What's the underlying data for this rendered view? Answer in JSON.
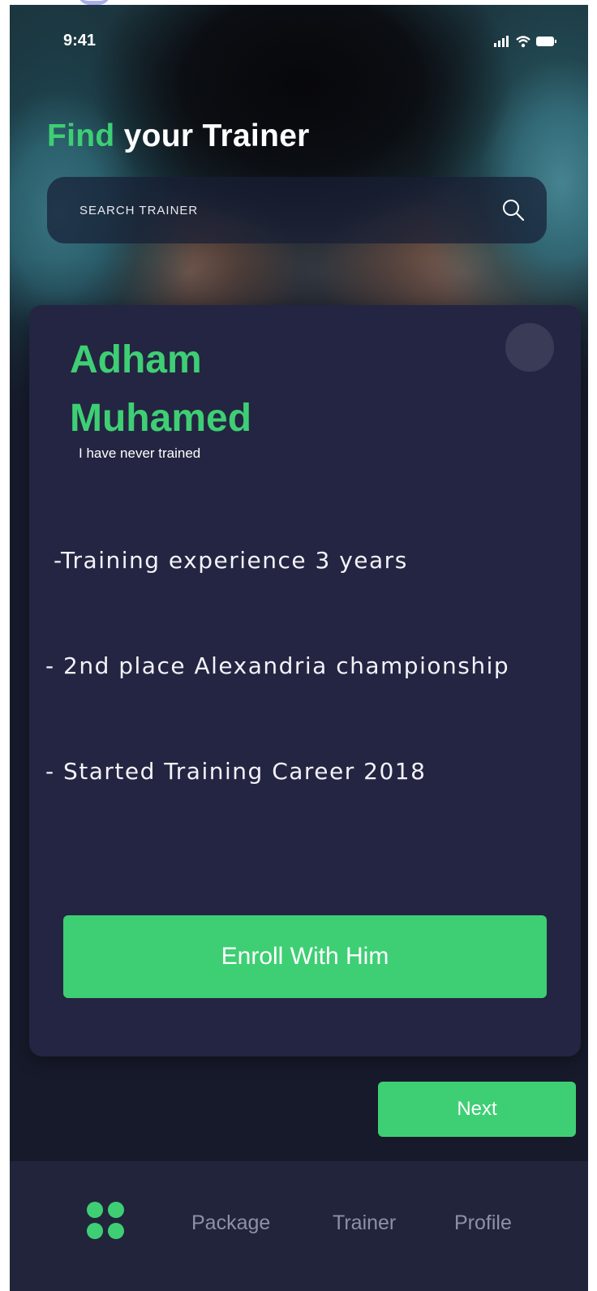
{
  "status_bar": {
    "time": "9:41",
    "icons": [
      "signal-icon",
      "wifi-icon",
      "battery-icon"
    ]
  },
  "header": {
    "title_accent": "Find",
    "title_rest": " your Trainer"
  },
  "search": {
    "placeholder": "SEARCH TRAINER",
    "icon": "search-icon"
  },
  "trainer_card": {
    "name_first": "Adham",
    "name_last": "Muhamed",
    "tagline": "I have never trained",
    "details": [
      "-Training experience 3 years",
      "- 2nd place Alexandria championship",
      "- Started Training Career 2018"
    ],
    "enroll_label": "Enroll With Him"
  },
  "next_label": "Next",
  "bottom_nav": {
    "items": [
      {
        "icon": "grid-dots-icon"
      },
      {
        "label": "Package"
      },
      {
        "label": "Trainer"
      },
      {
        "label": "Profile"
      }
    ]
  },
  "colors": {
    "accent": "#3ecf74",
    "background": "#171a2b",
    "card": "#242542",
    "nav": "#22243b"
  }
}
